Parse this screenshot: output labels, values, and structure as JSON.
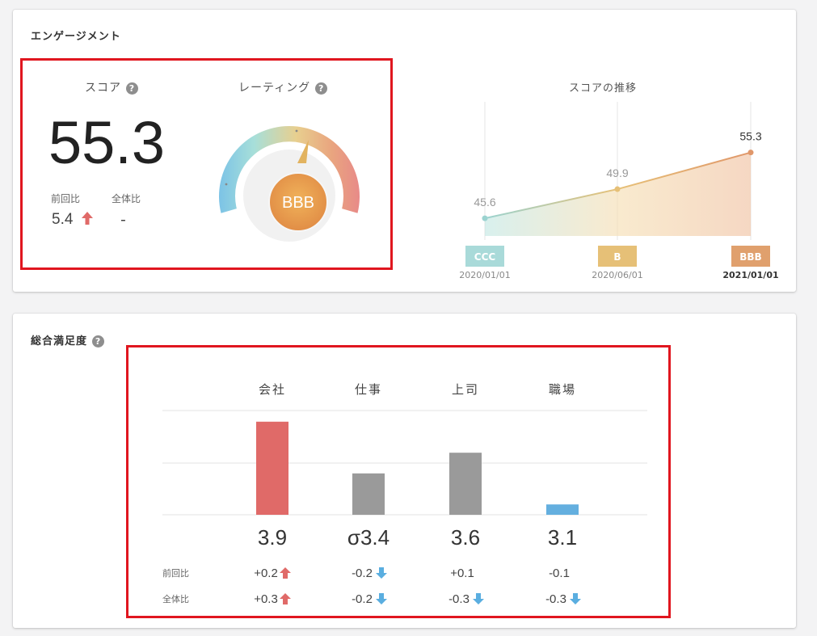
{
  "engagement": {
    "title": "エンゲージメント",
    "score_label": "スコア",
    "score_value": "55.3",
    "prev_label": "前回比",
    "overall_label": "全体比",
    "prev_value": "5.4",
    "overall_value": "-",
    "rating_label": "レーティング",
    "rating_value": "BBB",
    "help_glyph": "?"
  },
  "trend": {
    "title": "スコアの推移",
    "points": [
      {
        "date": "2020/01/01",
        "score": 45.6,
        "score_label": "45.6",
        "rating": "CCC",
        "rating_color": "#a9dad9"
      },
      {
        "date": "2020/06/01",
        "score": 49.9,
        "score_label": "49.9",
        "rating": "B",
        "rating_color": "#e6c077"
      },
      {
        "date": "2021/01/01",
        "score": 55.3,
        "score_label": "55.3",
        "rating": "BBB",
        "rating_color": "#e0a06d"
      }
    ]
  },
  "satisfaction": {
    "title": "総合満足度",
    "categories": [
      "会社",
      "仕事",
      "上司",
      "職場"
    ],
    "values": [
      "3.9",
      "σ3.4",
      "3.6",
      "3.1"
    ],
    "bar_values": [
      3.9,
      3.4,
      3.6,
      3.1
    ],
    "bar_colors": [
      "#e06a68",
      "#9a9a9a",
      "#9a9a9a",
      "#64afdf"
    ],
    "prev_label": "前回比",
    "overall_label": "全体比",
    "prev": [
      {
        "text": "+0.2",
        "dir": "up"
      },
      {
        "text": "-0.2",
        "dir": "down"
      },
      {
        "text": "+0.1",
        "dir": "none"
      },
      {
        "text": "-0.1",
        "dir": "none"
      }
    ],
    "overall": [
      {
        "text": "+0.3",
        "dir": "up"
      },
      {
        "text": "-0.2",
        "dir": "down"
      },
      {
        "text": "-0.3",
        "dir": "down"
      },
      {
        "text": "-0.3",
        "dir": "down"
      }
    ]
  },
  "colors": {
    "up_arrow": "#e06a68",
    "down_arrow": "#5aaee0",
    "highlight_border": "#e0161f"
  }
}
